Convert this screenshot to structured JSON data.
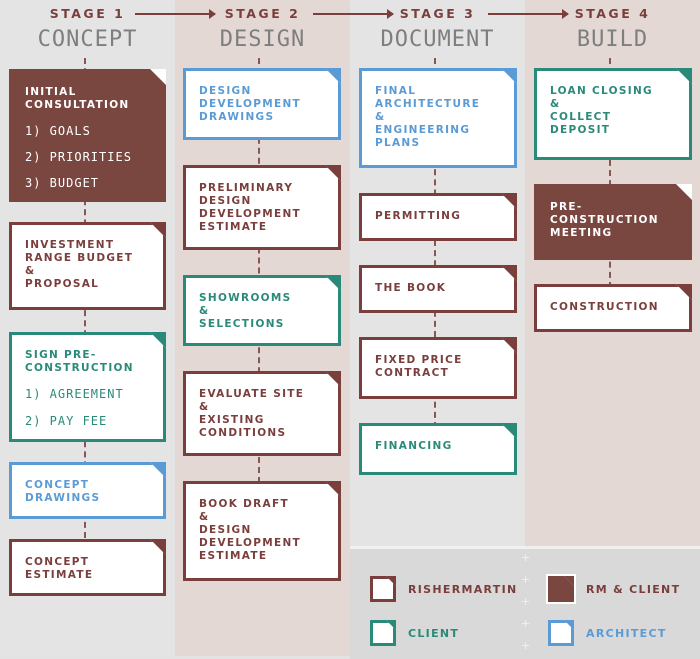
{
  "stages": [
    {
      "label": "STAGE 1",
      "name": "CONCEPT"
    },
    {
      "label": "STAGE 2",
      "name": "DESIGN"
    },
    {
      "label": "STAGE 3",
      "name": "DOCUMENT"
    },
    {
      "label": "STAGE 4",
      "name": "BUILD"
    }
  ],
  "colors": {
    "rishermartin": "#7a3e3c",
    "client": "#2a8a7a",
    "architect": "#5b9bd5",
    "rm_client": "#7a4640"
  },
  "stage1": {
    "initial_consultation": {
      "title": "INITIAL\nCONSULTATION",
      "items": [
        "1) GOALS",
        "2) PRIORITIES",
        "3) BUDGET"
      ],
      "owner": "rm_client"
    },
    "investment": {
      "title": "INVESTMENT\nRANGE BUDGET\n&\nPROPOSAL",
      "owner": "rishermartin"
    },
    "sign_pre": {
      "title": "SIGN PRE-\nCONSTRUCTION",
      "items": [
        "1) AGREEMENT",
        "2) PAY FEE"
      ],
      "owner": "client"
    },
    "concept_drawings": {
      "title": "CONCEPT\nDRAWINGS",
      "owner": "architect"
    },
    "concept_estimate": {
      "title": "CONCEPT\nESTIMATE",
      "owner": "rishermartin"
    }
  },
  "stage2": {
    "dd_drawings": {
      "title": "DESIGN\nDEVELOPMENT\nDRAWINGS",
      "owner": "architect"
    },
    "prelim_estimate": {
      "title": "PRELIMINARY\nDESIGN\nDEVELOPMENT\nESTIMATE",
      "owner": "rishermartin"
    },
    "showrooms": {
      "title": "SHOWROOMS\n&\nSELECTIONS",
      "owner": "client"
    },
    "evaluate_site": {
      "title": "EVALUATE SITE\n&\nEXISTING\nCONDITIONS",
      "owner": "rishermartin"
    },
    "book_draft": {
      "title": "BOOK DRAFT\n&\nDESIGN\nDEVELOPMENT\nESTIMATE",
      "owner": "rishermartin"
    }
  },
  "stage3": {
    "final_arch": {
      "title": "FINAL\nARCHITECTURE\n&\nENGINEERING\nPLANS",
      "owner": "architect"
    },
    "permitting": {
      "title": "PERMITTING",
      "owner": "rishermartin"
    },
    "the_book": {
      "title": "THE BOOK",
      "owner": "rishermartin"
    },
    "fixed_price": {
      "title": "FIXED PRICE\nCONTRACT",
      "owner": "rishermartin"
    },
    "financing": {
      "title": "FINANCING",
      "owner": "client"
    }
  },
  "stage4": {
    "loan_closing": {
      "title": "LOAN CLOSING\n&\nCOLLECT\nDEPOSIT",
      "owner": "client"
    },
    "pre_meeting": {
      "title": "PRE-\nCONSTRUCTION\nMEETING",
      "owner": "rm_client"
    },
    "construction": {
      "title": "CONSTRUCTION",
      "owner": "rishermartin"
    }
  },
  "legend": {
    "rishermartin": "RISHERMARTIN",
    "rm_client": "RM & CLIENT",
    "client": "CLIENT",
    "architect": "ARCHITECT"
  }
}
